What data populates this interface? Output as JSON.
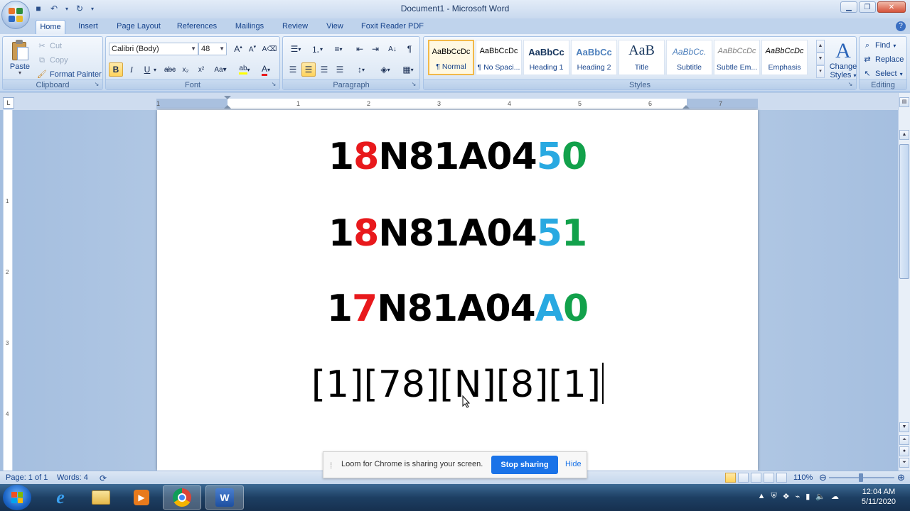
{
  "window": {
    "title": "Document1 - Microsoft Word"
  },
  "tabs": [
    "Home",
    "Insert",
    "Page Layout",
    "References",
    "Mailings",
    "Review",
    "View",
    "Foxit Reader PDF"
  ],
  "clipboard": {
    "paste": "Paste",
    "cut": "Cut",
    "copy": "Copy",
    "format_painter": "Format Painter",
    "label": "Clipboard"
  },
  "font": {
    "name": "Calibri (Body)",
    "size": "48",
    "label": "Font"
  },
  "paragraph": {
    "label": "Paragraph"
  },
  "styles": {
    "items": [
      {
        "sample": "AaBbCcDc",
        "name": "¶ Normal"
      },
      {
        "sample": "AaBbCcDc",
        "name": "¶ No Spaci..."
      },
      {
        "sample": "AaBbCc",
        "name": "Heading 1"
      },
      {
        "sample": "AaBbCc",
        "name": "Heading 2"
      },
      {
        "sample": "AaB",
        "name": "Title"
      },
      {
        "sample": "AaBbCc.",
        "name": "Subtitle"
      },
      {
        "sample": "AaBbCcDc",
        "name": "Subtle Em..."
      },
      {
        "sample": "AaBbCcDc",
        "name": "Emphasis"
      }
    ],
    "change_styles_1": "Change",
    "change_styles_2": "Styles",
    "label": "Styles"
  },
  "editing": {
    "find": "Find",
    "replace": "Replace",
    "select": "Select",
    "label": "Editing"
  },
  "ruler": {
    "numbers": [
      "1",
      "1",
      "2",
      "3",
      "4",
      "5",
      "6",
      "7"
    ]
  },
  "document": {
    "lines": [
      [
        {
          "t": "1",
          "c": "#000000"
        },
        {
          "t": "8",
          "c": "#e8191c"
        },
        {
          "t": "N81A04",
          "c": "#000000"
        },
        {
          "t": "5",
          "c": "#29a9e1"
        },
        {
          "t": "0",
          "c": "#12a14b"
        }
      ],
      [
        {
          "t": "1",
          "c": "#000000"
        },
        {
          "t": "8",
          "c": "#e8191c"
        },
        {
          "t": "N81A04",
          "c": "#000000"
        },
        {
          "t": "5",
          "c": "#29a9e1"
        },
        {
          "t": "1",
          "c": "#12a14b"
        }
      ],
      [
        {
          "t": "1",
          "c": "#000000"
        },
        {
          "t": "7",
          "c": "#e8191c"
        },
        {
          "t": "N81A04",
          "c": "#000000"
        },
        {
          "t": "A",
          "c": "#29a9e1"
        },
        {
          "t": "0",
          "c": "#12a14b"
        }
      ]
    ],
    "last_line": "[1][78][N][8][1]"
  },
  "notification": {
    "message": "Loom for Chrome is sharing your screen.",
    "stop": "Stop sharing",
    "hide": "Hide"
  },
  "status": {
    "page": "Page: 1 of 1",
    "words": "Words: 4",
    "zoom": "110%"
  },
  "clock": {
    "time": "12:04 AM",
    "date": "5/11/2020"
  }
}
